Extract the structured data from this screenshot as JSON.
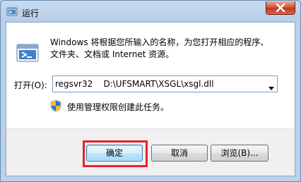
{
  "window": {
    "title": "运行",
    "app_icon": "run-dialog-icon",
    "close_icon": "close-x-icon"
  },
  "content": {
    "description_line1": "Windows 将根据您所输入的名称，为您打开相应的程序、",
    "description_line2": "文件夹、文档或 Internet 资源。",
    "open_label": "打开(O):",
    "command_value": "regsvr32    D:\\UFSMART\\XSGL\\xsgl.dll",
    "dropdown_icon": "chevron-down-icon",
    "admin_icon": "uac-shield-icon",
    "admin_note": "使用管理权限创建此任务。"
  },
  "buttons": {
    "ok": "确定",
    "cancel": "取消",
    "browse": "浏览(B)..."
  },
  "annotation": {
    "highlight_color": "#e8202a",
    "highlight_target": "ok-button"
  }
}
